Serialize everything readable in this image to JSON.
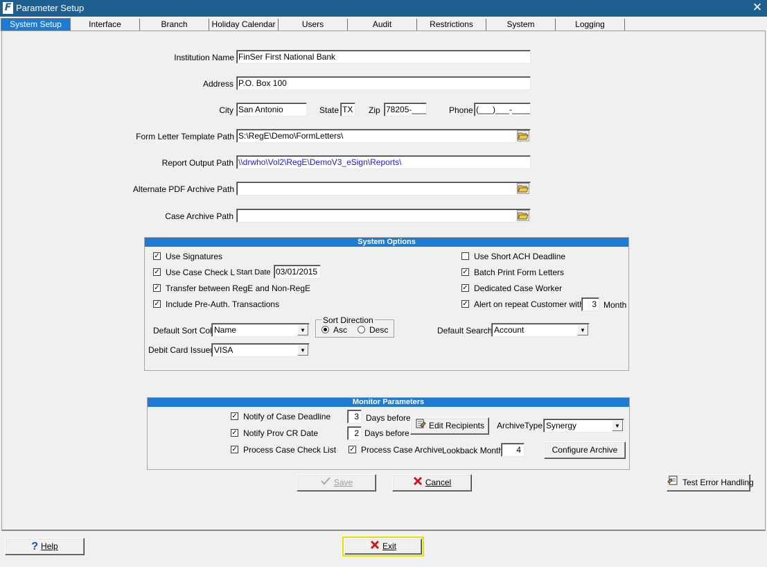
{
  "window": {
    "title": "Parameter Setup",
    "app_icon": "F",
    "close_glyph": "✕"
  },
  "tabs": [
    {
      "label": "System Setup"
    },
    {
      "label": "Interface"
    },
    {
      "label": "Branch"
    },
    {
      "label": "Holiday Calendar"
    },
    {
      "label": "Users"
    },
    {
      "label": "Audit"
    },
    {
      "label": "Restrictions"
    },
    {
      "label": "System"
    },
    {
      "label": "Logging"
    }
  ],
  "institution": {
    "name_label": "Institution Name",
    "name_value": "FinSer First National Bank",
    "address_label": "Address",
    "address_value": "P.O. Box 100",
    "city_label": "City",
    "city_value": "San Antonio",
    "state_label": "State",
    "state_value": "TX",
    "zip_label": "Zip",
    "zip_value": "78205-____",
    "phone_label": "Phone",
    "phone_value": "(___)___-____"
  },
  "paths": {
    "form_letter_label": "Form Letter Template Path",
    "form_letter_value": "S:\\RegE\\Demo\\FormLetters\\",
    "report_output_label": "Report Output Path",
    "report_output_value": "\\\\drwho\\Vol2\\RegE\\DemoV3_eSign\\Reports\\",
    "alt_pdf_label": "Alternate PDF Archive Path",
    "alt_pdf_value": "",
    "case_archive_label": "Case Archive Path",
    "case_archive_value": ""
  },
  "system_options": {
    "title": "System Options",
    "use_signatures": "Use Signatures",
    "use_case_checklist": "Use Case Check List",
    "start_date_label": "Start Date",
    "start_date_value": "03/01/2015",
    "transfer_between": "Transfer between RegE and Non-RegE",
    "include_preauth": "Include Pre-Auth. Transactions",
    "use_short_ach": "Use Short ACH Deadline",
    "batch_print": "Batch Print Form Letters",
    "dedicated_worker": "Dedicated Case Worker",
    "alert_repeat": "Alert on repeat Customer within",
    "alert_months_value": "3",
    "month_label": "Month",
    "default_sort_label": "Default Sort Col",
    "default_sort_value": "Name",
    "sort_direction_label": "Sort Direction",
    "asc_label": "Asc",
    "desc_label": "Desc",
    "default_search_label": "Default Search",
    "default_search_value": "Account",
    "debit_issuer_label": "Debit Card Issuer",
    "debit_issuer_value": "VISA"
  },
  "monitor": {
    "title": "Monitor Parameters",
    "notify_deadline": "Notify of Case Deadline",
    "deadline_days": "3",
    "days_before_1": "Days before",
    "notify_prov": "Notify Prov CR Date",
    "prov_days": "2",
    "days_before_2": "Days before",
    "process_checklist": "Process Case Check List",
    "process_archive": "Process Case Archive",
    "edit_recipients": "Edit Recipients",
    "archive_type_label": "ArchiveType",
    "archive_type_value": "Synergy",
    "lookback_label": "Lookback Month",
    "lookback_value": "4",
    "configure_archive": "Configure Archive"
  },
  "buttons": {
    "save": "Save",
    "cancel": "Cancel",
    "test_error": "Test Error Handling",
    "help": "Help",
    "exit": "Exit"
  },
  "colors": {
    "titlebar": "#1f5f8f",
    "tab_active": "#1f7bd1",
    "group_head": "#1f7bd1",
    "link": "#1a1acd"
  }
}
